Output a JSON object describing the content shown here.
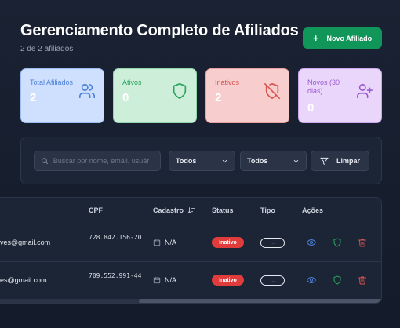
{
  "header": {
    "title": "Gerenciamento Completo de Afiliados",
    "subtitle": "2 de 2 afiliados",
    "new_button_label": "Novo Afiliado"
  },
  "stats": [
    {
      "label": "Total Afiliados",
      "value": "2",
      "icon": "users-icon",
      "color": "#4c7fd9"
    },
    {
      "label": "Ativos",
      "value": "0",
      "icon": "shield-check-icon",
      "color": "#2aa45f"
    },
    {
      "label": "Inativos",
      "value": "2",
      "icon": "shield-off-icon",
      "color": "#d9534f"
    },
    {
      "label": "Novos (30 dias)",
      "value": "0",
      "icon": "user-plus-icon",
      "color": "#9b59d0"
    }
  ],
  "filters": {
    "search_placeholder": "Buscar por nome, email, usuár",
    "select1_value": "Todos",
    "select2_value": "Todos",
    "clear_label": "Limpar"
  },
  "table": {
    "headers": {
      "cpf": "CPF",
      "cadastro": "Cadastro",
      "status": "Status",
      "tipo": "Tipo",
      "acoes": "Ações"
    },
    "rows": [
      {
        "email": "ves@gmail.com",
        "cpf": "728.842.156-20",
        "cadastro": "N/A",
        "status": "Inativo",
        "tipo": "..."
      },
      {
        "email": "es@gmail.com",
        "cpf": "709.552.991-44",
        "cadastro": "N/A",
        "status": "Inativo",
        "tipo": "..."
      }
    ]
  },
  "colors": {
    "primary_button": "#11965a",
    "status_inativo": "#e03c3c",
    "background": "#161d2b"
  }
}
